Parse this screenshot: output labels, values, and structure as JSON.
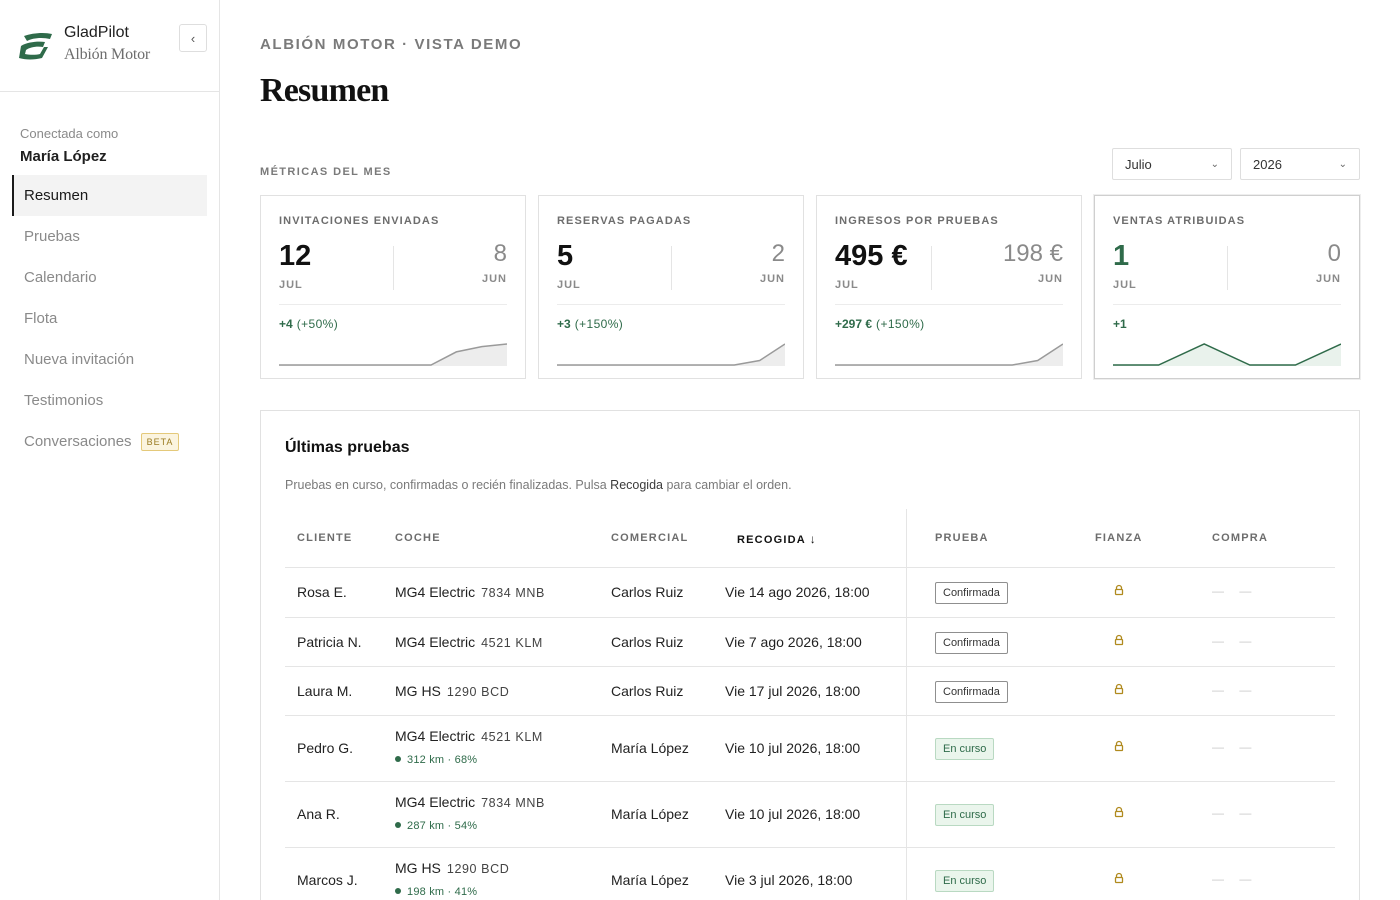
{
  "brand": {
    "name": "GladPilot",
    "dealer": "Albión Motor",
    "collapse_icon": "chevron-left-icon"
  },
  "user": {
    "caption": "Conectada como",
    "name": "María López"
  },
  "nav": [
    {
      "label": "Resumen",
      "active": true
    },
    {
      "label": "Pruebas"
    },
    {
      "label": "Calendario"
    },
    {
      "label": "Flota"
    },
    {
      "label": "Nueva invitación"
    },
    {
      "label": "Testimonios"
    },
    {
      "label": "Conversaciones",
      "badge": "BETA"
    }
  ],
  "header": {
    "eyebrow": "ALBIÓN MOTOR · VISTA DEMO",
    "title": "Resumen"
  },
  "metrics": {
    "section_label": "MÉTRICAS DEL MES",
    "month_select": "Julio",
    "year_select": "2026",
    "cards": [
      {
        "title": "INVITACIONES ENVIADAS",
        "current": "12",
        "current_label": "JUL",
        "previous": "8",
        "previous_label": "JUN",
        "delta": "+4",
        "delta_pct": "(+50%)",
        "trend": [
          0,
          0,
          0,
          0,
          0,
          0,
          0,
          1,
          1.4,
          1.6
        ]
      },
      {
        "title": "RESERVAS PAGADAS",
        "current": "5",
        "current_label": "JUL",
        "previous": "2",
        "previous_label": "JUN",
        "delta": "+3",
        "delta_pct": "(+150%)",
        "trend": [
          0,
          0,
          0,
          0,
          0,
          0,
          0,
          0,
          0.3,
          1.4
        ]
      },
      {
        "title": "INGRESOS POR PRUEBAS",
        "current": "495 €",
        "current_label": "JUL",
        "previous": "198 €",
        "previous_label": "JUN",
        "delta": "+297 €",
        "delta_pct": "(+150%)",
        "trend": [
          0,
          0,
          0,
          0,
          0,
          0,
          0,
          0,
          0.3,
          1.4
        ]
      },
      {
        "title": "VENTAS ATRIBUIDAS",
        "current": "1",
        "current_label": "JUL",
        "previous": "0",
        "previous_label": "JUN",
        "delta": "+1",
        "delta_pct": "",
        "trend": [
          0,
          0,
          1,
          0,
          0,
          1
        ],
        "highlight": true
      }
    ]
  },
  "tests": {
    "title": "Últimas pruebas",
    "desc_before": "Pruebas en curso, confirmadas o recién finalizadas. Pulsa ",
    "desc_em": "Recogida",
    "desc_after": " para cambiar el orden.",
    "columns": {
      "client": "CLIENTE",
      "car": "COCHE",
      "sales": "COMERCIAL",
      "pickup": "RECOGIDA",
      "sort_icon": "arrow-down-icon",
      "test": "PRUEBA",
      "deposit": "FIANZA",
      "purchase": "COMPRA"
    },
    "rows": [
      {
        "client": "Rosa E.",
        "car": "MG4 Electric",
        "plate": "7834 MNB",
        "battery": "",
        "sales": "Carlos Ruiz",
        "pickup": "Vie 14 ago 2026, 18:00",
        "status": "Confirmada",
        "status_type": "conf",
        "deposit_icon": "lock-icon",
        "purchase": "— —"
      },
      {
        "client": "Patricia N.",
        "car": "MG4 Electric",
        "plate": "4521 KLM",
        "battery": "",
        "sales": "Carlos Ruiz",
        "pickup": "Vie 7 ago 2026, 18:00",
        "status": "Confirmada",
        "status_type": "conf",
        "deposit_icon": "lock-icon",
        "purchase": "— —"
      },
      {
        "client": "Laura M.",
        "car": "MG HS",
        "plate": "1290 BCD",
        "battery": "",
        "sales": "Carlos Ruiz",
        "pickup": "Vie 17 jul 2026, 18:00",
        "status": "Confirmada",
        "status_type": "conf",
        "deposit_icon": "lock-icon",
        "purchase": "— —"
      },
      {
        "client": "Pedro G.",
        "car": "MG4 Electric",
        "plate": "4521 KLM",
        "battery": "312 km · 68%",
        "sales": "María López",
        "pickup": "Vie 10 jul 2026, 18:00",
        "status": "En curso",
        "status_type": "curso",
        "deposit_icon": "lock-icon",
        "purchase": "— —"
      },
      {
        "client": "Ana R.",
        "car": "MG4 Electric",
        "plate": "7834 MNB",
        "battery": "287 km · 54%",
        "sales": "María López",
        "pickup": "Vie 10 jul 2026, 18:00",
        "status": "En curso",
        "status_type": "curso",
        "deposit_icon": "lock-icon",
        "purchase": "— —"
      },
      {
        "client": "Marcos J.",
        "car": "MG HS",
        "plate": "1290 BCD",
        "battery": "198 km · 41%",
        "sales": "María López",
        "pickup": "Vie 3 jul 2026, 18:00",
        "status": "En curso",
        "status_type": "curso",
        "deposit_icon": "lock-icon",
        "purchase": "— —"
      }
    ]
  },
  "colors": {
    "accent_green": "#2f6b4a",
    "beta_bg": "#fbf4df",
    "beta_border": "#e4c97a",
    "lock_gold": "#b08a1e",
    "sidebar_border": "#e5e5e5"
  }
}
